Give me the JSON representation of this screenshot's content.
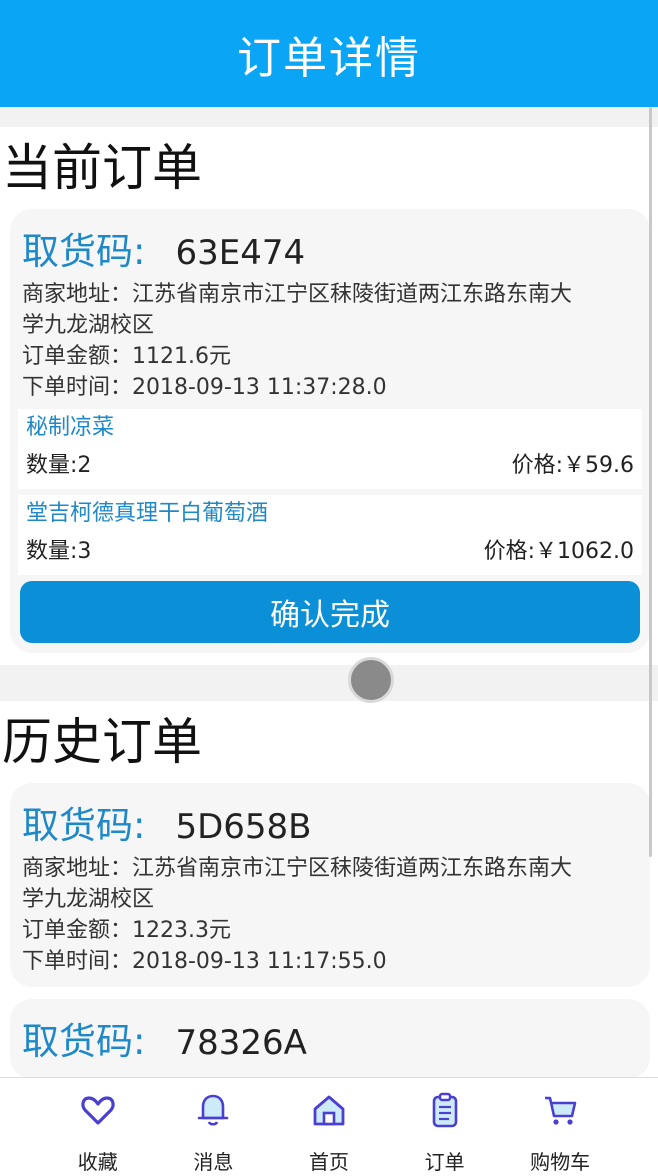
{
  "header": {
    "title": "订单详情"
  },
  "current": {
    "section_title": "当前订单",
    "order": {
      "pick_label": "取货码:",
      "pick_code": "63E474",
      "address_line1": "商家地址：江苏省南京市江宁区秣陵街道两江东路东南大",
      "address_line2": "学九龙湖校区",
      "amount": "订单金额：1121.6元",
      "time": "下单时间：2018-09-13 11:37:28.0",
      "items": [
        {
          "name": "秘制凉菜",
          "qty": "数量:2",
          "price": "价格:￥59.6"
        },
        {
          "name": "堂吉柯德真理干白葡萄酒",
          "qty": "数量:3",
          "price": "价格:￥1062.0"
        }
      ],
      "confirm_label": "确认完成"
    }
  },
  "history": {
    "section_title": "历史订单",
    "orders": [
      {
        "pick_label": "取货码:",
        "pick_code": "5D658B",
        "address_line1": "商家地址：江苏省南京市江宁区秣陵街道两江东路东南大",
        "address_line2": "学九龙湖校区",
        "amount": "订单金额：1223.3元",
        "time": "下单时间：2018-09-13 11:17:55.0"
      },
      {
        "pick_label": "取货码:",
        "pick_code": "78326A"
      }
    ]
  },
  "tabbar": {
    "items": [
      {
        "label": "收藏",
        "icon": "heart-icon"
      },
      {
        "label": "消息",
        "icon": "bell-icon"
      },
      {
        "label": "首页",
        "icon": "home-icon"
      },
      {
        "label": "订单",
        "icon": "clipboard-icon"
      },
      {
        "label": "购物车",
        "icon": "cart-icon"
      }
    ]
  },
  "colors": {
    "header": "#0aa6f5",
    "accent": "#1e88c8",
    "button": "#0b8fd6",
    "icon": "#4a3fd1"
  }
}
